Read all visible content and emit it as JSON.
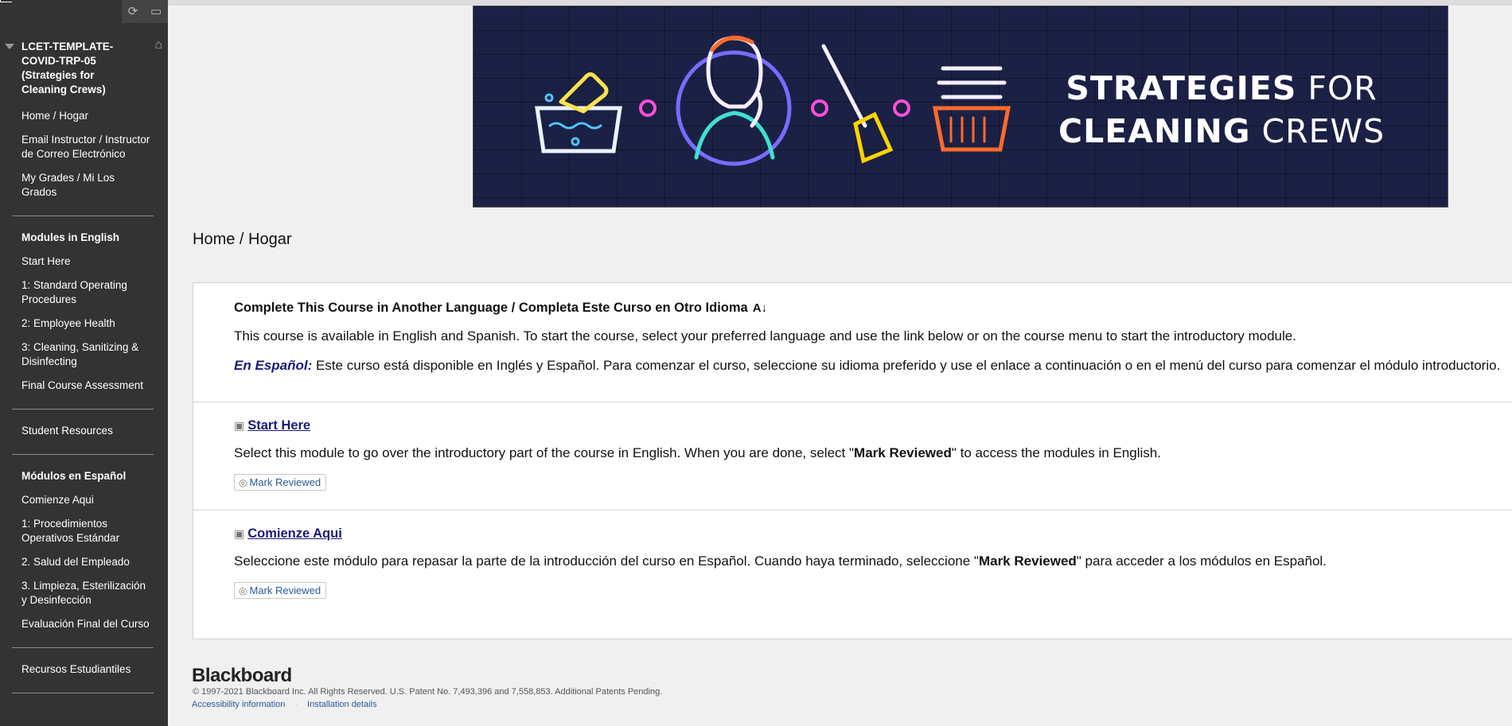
{
  "sidebar": {
    "tools": {
      "refresh_icon": "refresh-icon",
      "folder_icon": "folder-icon"
    },
    "course_title": "LCET-TEMPLATE-COVID-TRP-05 (Strategies for Cleaning Crews)",
    "items": [
      "Home / Hogar",
      "Email Instructor / Instructor de Correo Electrónico",
      "My Grades / Mi Los Grados"
    ],
    "english_heading": "Modules in English",
    "english_items": [
      "Start Here",
      "1: Standard Operating Procedures",
      "2: Employee Health",
      "3: Cleaning, Sanitizing & Disinfecting",
      "Final Course Assessment"
    ],
    "student_resources": "Student Resources",
    "spanish_heading": "Módulos en Español",
    "spanish_items": [
      "Comienze Aqui",
      "1: Procedimientos Operativos Estándar",
      "2. Salud del Empleado",
      "3. Limpieza, Esterilización y Desinfección",
      "Evaluación Final del Curso"
    ],
    "spanish_resources": "Recursos Estudiantiles"
  },
  "banner": {
    "line1_bold": "STRATEGIES",
    "line1_rest": " FOR",
    "line2_bold": "CLEANING",
    "line2_rest": " CREWS"
  },
  "page": {
    "title": "Home / Hogar"
  },
  "items": {
    "language": {
      "heading": "Complete This Course in Another Language / Completa Este Curso en Otro Idioma",
      "text_en": "This course is available in English and Spanish. To start the course, select your preferred language and use the link below or on the course menu to start the introductory module.",
      "es_label": "En Español:",
      "text_es": " Este curso está disponible en Inglés y Español. Para comenzar el curso, seleccione su idioma preferido y use el enlace a continuación o en el menú del curso para comenzar el módulo introductorio."
    },
    "start_here": {
      "link": "Start Here",
      "text_before": "Select this module to go over the introductory part of the course in English. When you are done, select \"",
      "text_bold": "Mark Reviewed",
      "text_after": "\" to access the modules in English.",
      "button": "Mark Reviewed"
    },
    "comienze": {
      "link": "Comienze Aqui",
      "text_before": "Seleccione este módulo para repasar la parte de la introducción del curso en Español. Cuando haya terminado, seleccione \"",
      "text_bold": "Mark Reviewed",
      "text_after": "\" para acceder a los módulos en Español.",
      "button": "Mark Reviewed"
    }
  },
  "footer": {
    "logo": "Blackboard",
    "copyright": "© 1997-2021 Blackboard Inc. All Rights Reserved. U.S. Patent No. 7,493,396 and 7,558,853. Additional Patents Pending.",
    "accessibility": "Accessibility information",
    "installation": "Installation details"
  }
}
